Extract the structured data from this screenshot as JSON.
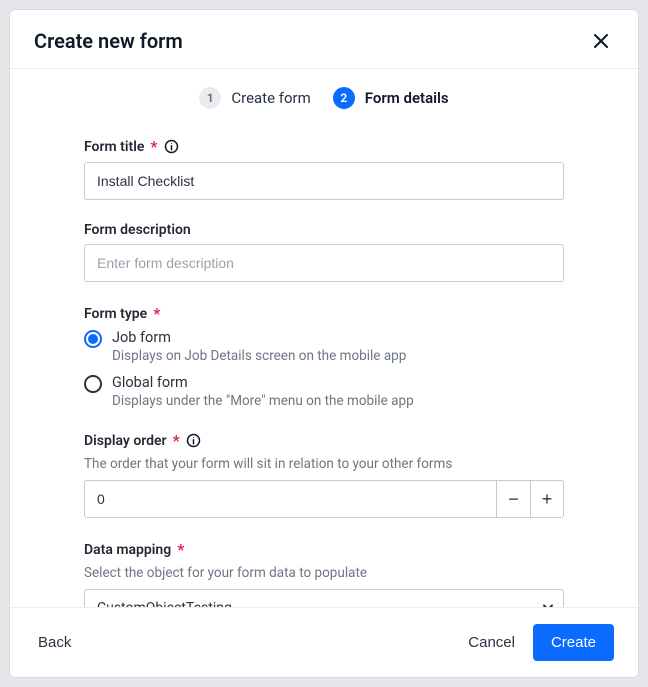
{
  "header": {
    "title": "Create new form"
  },
  "stepper": {
    "steps": [
      {
        "num": "1",
        "label": "Create form",
        "active": false
      },
      {
        "num": "2",
        "label": "Form details",
        "active": true
      }
    ]
  },
  "fields": {
    "formTitle": {
      "label": "Form title",
      "required": "*",
      "value": "Install Checklist"
    },
    "formDescription": {
      "label": "Form description",
      "placeholder": "Enter form description",
      "value": ""
    },
    "formType": {
      "label": "Form type",
      "required": "*",
      "options": {
        "job": {
          "title": "Job form",
          "desc": "Displays on Job Details screen on the mobile app",
          "checked": true
        },
        "global": {
          "title": "Global form",
          "desc": "Displays under the \"More\" menu on the mobile app",
          "checked": false
        }
      }
    },
    "displayOrder": {
      "label": "Display order",
      "required": "*",
      "sub": "The order that your form will sit in relation to your other forms",
      "value": "0"
    },
    "dataMapping": {
      "label": "Data mapping",
      "required": "*",
      "sub": "Select the object for your form data to populate",
      "value": "CustomObjectTesting"
    }
  },
  "footer": {
    "back": "Back",
    "cancel": "Cancel",
    "create": "Create"
  }
}
